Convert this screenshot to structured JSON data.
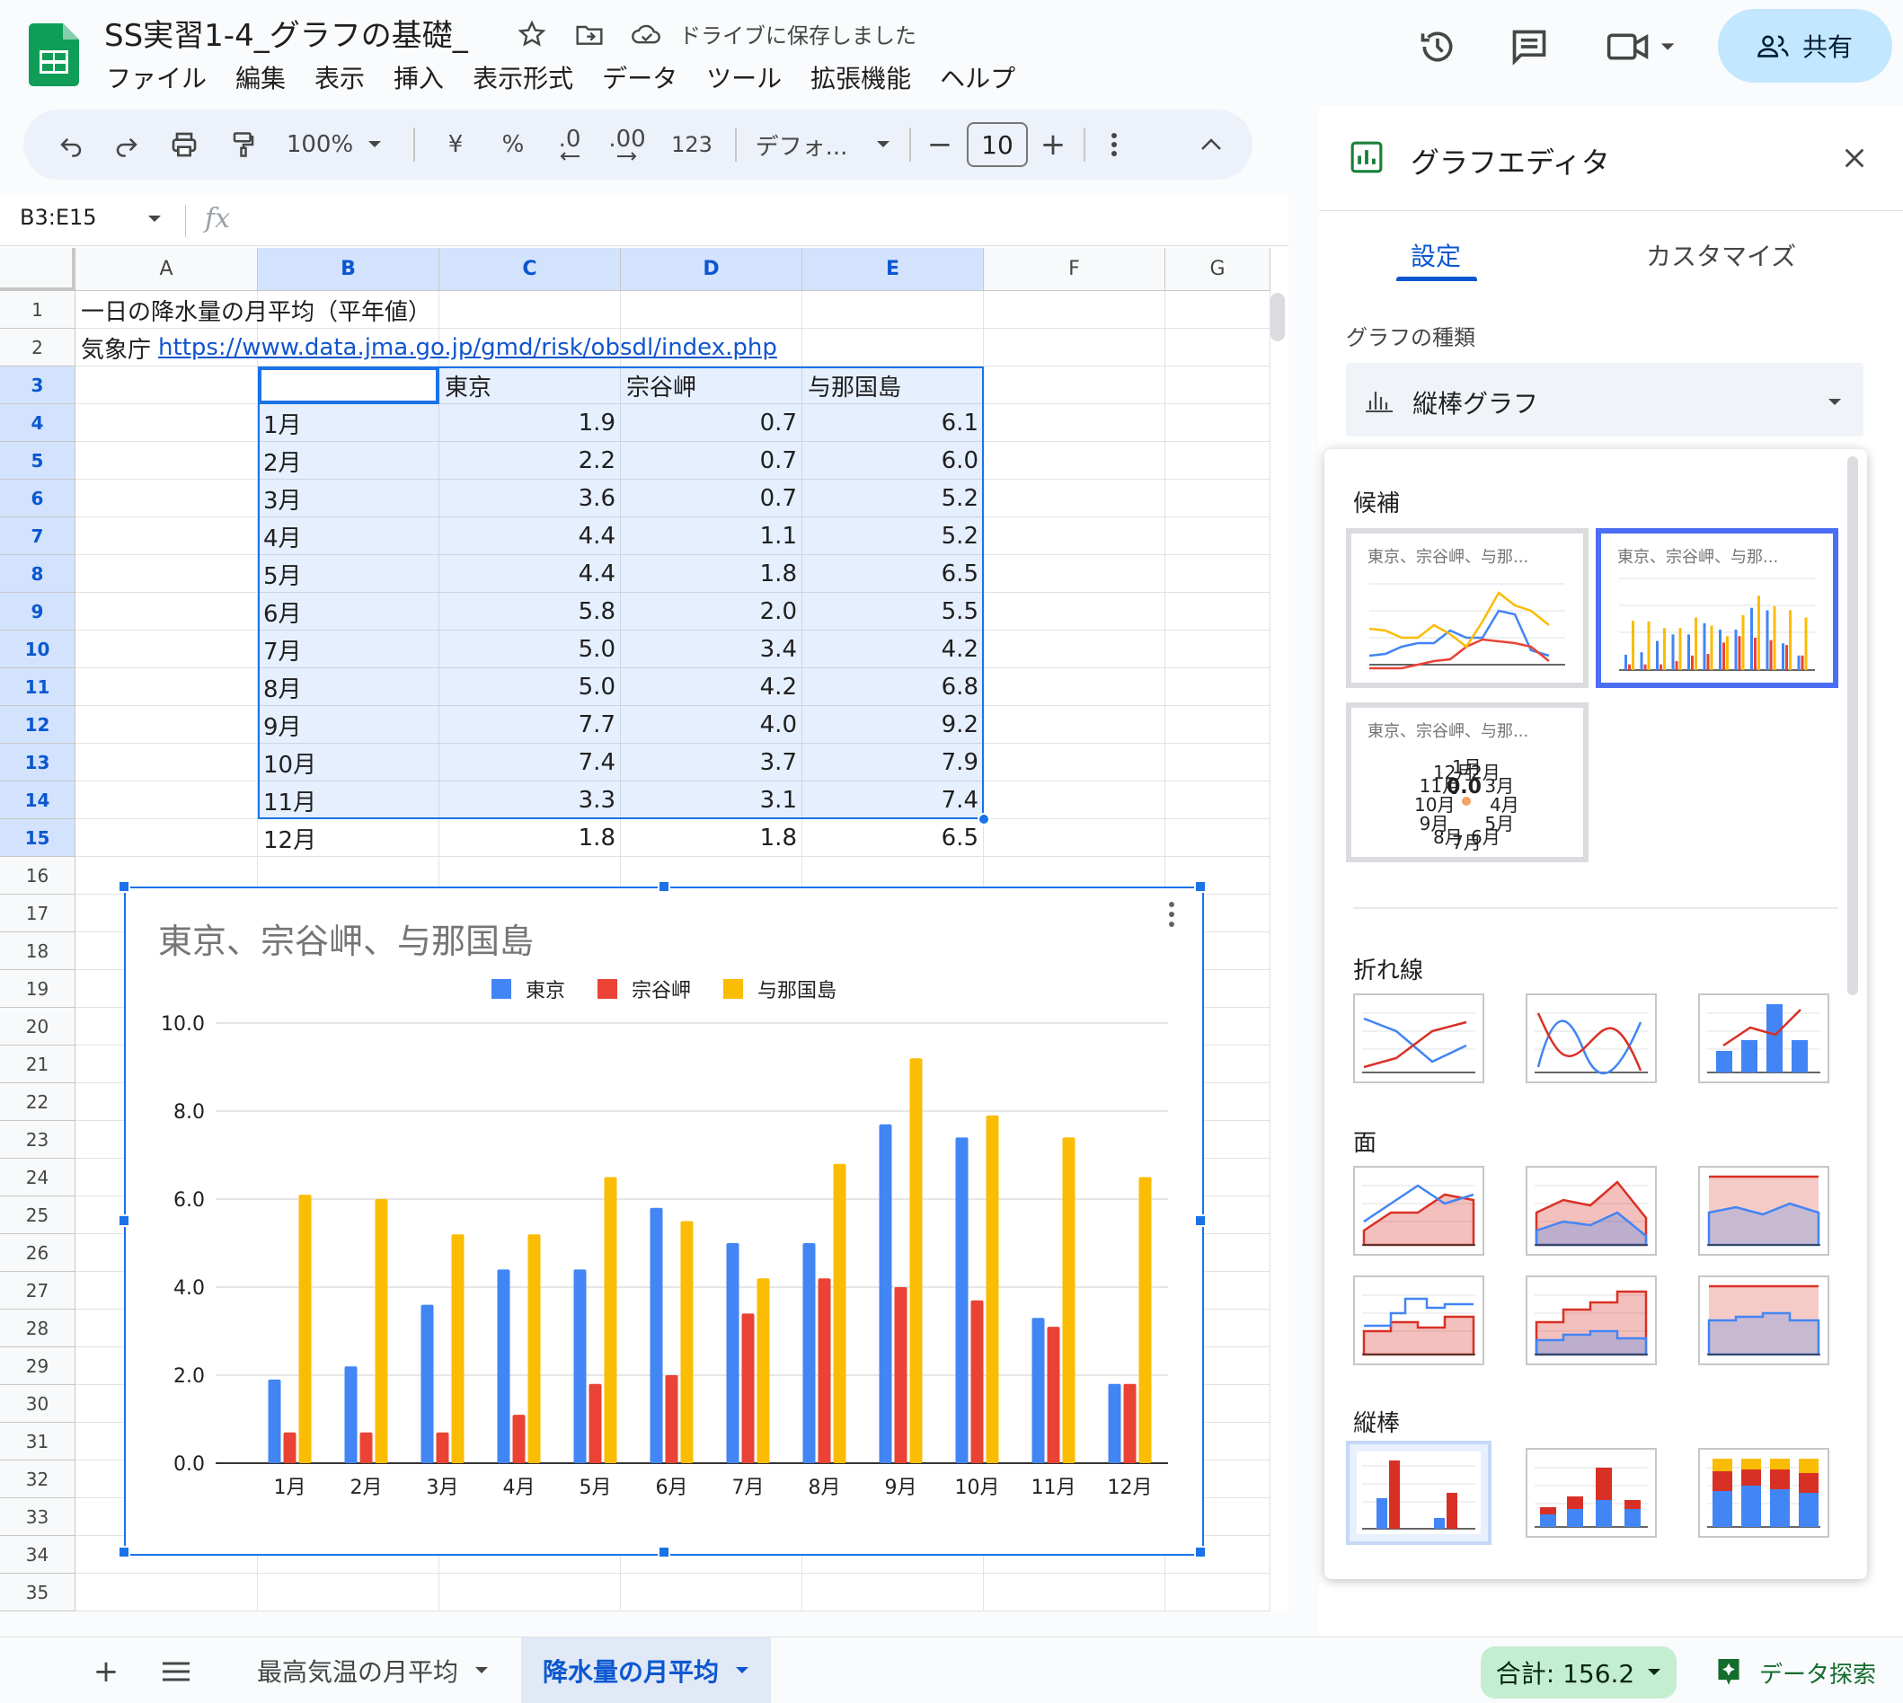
{
  "doc": {
    "title": "SS実習1-4_グラフの基礎_",
    "save_status": "ドライブに保存しました",
    "share_label": "共有"
  },
  "menu": [
    "ファイル",
    "編集",
    "表示",
    "挿入",
    "表示形式",
    "データ",
    "ツール",
    "拡張機能",
    "ヘルプ"
  ],
  "toolbar": {
    "zoom": "100%",
    "currency": "¥",
    "percent": "%",
    "dec_decrease": ".0",
    "dec_increase": ".00",
    "number_format": "123",
    "font": "デフォ...",
    "font_size": "10",
    "minus": "−",
    "plus": "+"
  },
  "formula_bar": {
    "name_box": "B3:E15",
    "fx": "fx",
    "content": ""
  },
  "grid": {
    "columns": [
      "A",
      "B",
      "C",
      "D",
      "E",
      "F",
      "G"
    ],
    "selected_columns": [
      "B",
      "C",
      "D",
      "E"
    ],
    "rows": [
      "1",
      "2",
      "3",
      "4",
      "5",
      "6",
      "7",
      "8",
      "9",
      "10",
      "11",
      "12",
      "13",
      "14",
      "15",
      "16",
      "17",
      "18",
      "19",
      "20",
      "21",
      "22",
      "23",
      "24",
      "25",
      "26",
      "27",
      "28",
      "29",
      "30",
      "31",
      "32",
      "33",
      "34",
      "35"
    ],
    "selected_rows": [
      "3",
      "4",
      "5",
      "6",
      "7",
      "8",
      "9",
      "10",
      "11",
      "12",
      "13",
      "14",
      "15"
    ],
    "a1": "一日の降水量の月平均（平年値）",
    "a2_prefix": "気象庁",
    "a2_link": "https://www.data.jma.go.jp/gmd/risk/obsdl/index.php",
    "table_header": [
      "",
      "東京",
      "宗谷岬",
      "与那国島"
    ],
    "table_rows": [
      [
        "1月",
        "1.9",
        "0.7",
        "6.1"
      ],
      [
        "2月",
        "2.2",
        "0.7",
        "6.0"
      ],
      [
        "3月",
        "3.6",
        "0.7",
        "5.2"
      ],
      [
        "4月",
        "4.4",
        "1.1",
        "5.2"
      ],
      [
        "5月",
        "4.4",
        "1.8",
        "6.5"
      ],
      [
        "6月",
        "5.8",
        "2.0",
        "5.5"
      ],
      [
        "7月",
        "5.0",
        "3.4",
        "4.2"
      ],
      [
        "8月",
        "5.0",
        "4.2",
        "6.8"
      ],
      [
        "9月",
        "7.7",
        "4.0",
        "9.2"
      ],
      [
        "10月",
        "7.4",
        "3.7",
        "7.9"
      ],
      [
        "11月",
        "3.3",
        "3.1",
        "7.4"
      ],
      [
        "12月",
        "1.8",
        "1.8",
        "6.5"
      ]
    ]
  },
  "chart_data": {
    "type": "bar",
    "title": "東京、宗谷岬、与那国島",
    "categories": [
      "1月",
      "2月",
      "3月",
      "4月",
      "5月",
      "6月",
      "7月",
      "8月",
      "9月",
      "10月",
      "11月",
      "12月"
    ],
    "series": [
      {
        "name": "東京",
        "color": "#4285f4",
        "values": [
          1.9,
          2.2,
          3.6,
          4.4,
          4.4,
          5.8,
          5.0,
          5.0,
          7.7,
          7.4,
          3.3,
          1.8
        ]
      },
      {
        "name": "宗谷岬",
        "color": "#ea4335",
        "values": [
          0.7,
          0.7,
          0.7,
          1.1,
          1.8,
          2.0,
          3.4,
          4.2,
          4.0,
          3.7,
          3.1,
          1.8
        ]
      },
      {
        "name": "与那国島",
        "color": "#fbbc04",
        "values": [
          6.1,
          6.0,
          5.2,
          5.2,
          6.5,
          5.5,
          4.2,
          6.8,
          9.2,
          7.9,
          7.4,
          6.5
        ]
      }
    ],
    "yticks": [
      "0.0",
      "2.0",
      "4.0",
      "6.0",
      "8.0",
      "10.0"
    ],
    "ylim": [
      0,
      10
    ],
    "legend": "top",
    "grid": true
  },
  "sheets": {
    "tabs": [
      {
        "label": "最高気温の月平均",
        "active": false
      },
      {
        "label": "降水量の月平均",
        "active": true
      }
    ],
    "sum_label": "合計: 156.2",
    "explore_label": "データ探索"
  },
  "editor": {
    "title": "グラフエディタ",
    "tab_setup": "設定",
    "tab_customize": "カスタマイズ",
    "chart_type_label": "グラフの種類",
    "chart_type_value": "縦棒グラフ",
    "dropdown": {
      "section_suggest": "候補",
      "section_line": "折れ線",
      "section_area": "面",
      "section_column": "縦棒",
      "thumb_title": "東京、宗谷岬、与那...",
      "pie_labels": [
        "1月",
        "2月",
        "3月",
        "4月",
        "5月",
        "6月",
        "7月",
        "8月",
        "9月",
        "10月",
        "11月",
        "12月"
      ],
      "pie_center": "0.0"
    }
  }
}
